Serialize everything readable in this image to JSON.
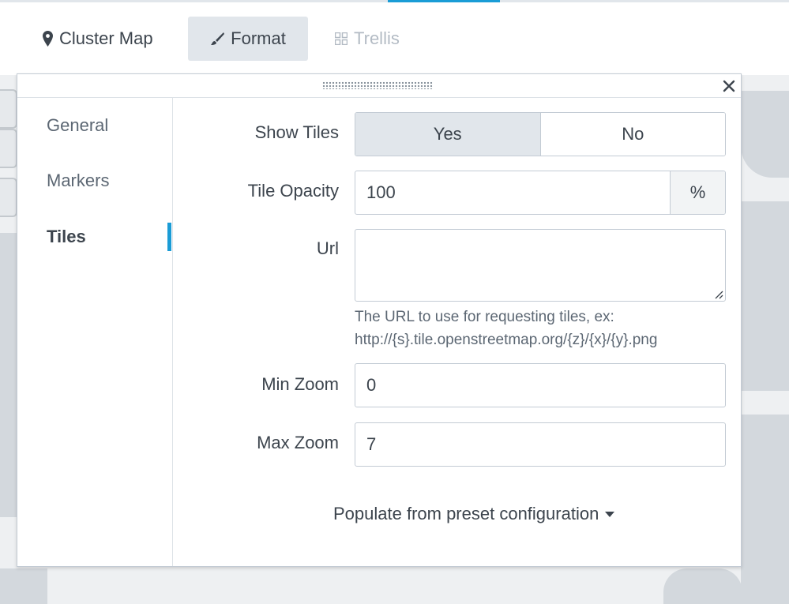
{
  "toolbar": {
    "cluster_map_label": "Cluster Map",
    "format_label": "Format",
    "trellis_label": "Trellis"
  },
  "panel": {
    "side_nav": [
      {
        "label": "General"
      },
      {
        "label": "Markers"
      },
      {
        "label": "Tiles",
        "active": true
      }
    ],
    "show_tiles": {
      "label": "Show Tiles",
      "options": [
        "Yes",
        "No"
      ],
      "selected": "Yes"
    },
    "tile_opacity": {
      "label": "Tile Opacity",
      "value": "100",
      "unit": "%"
    },
    "url": {
      "label": "Url",
      "value": "",
      "help_line1": "The URL to use for requesting tiles, ex:",
      "help_line2": "http://{s}.tile.openstreetmap.org/{z}/{x}/{y}.png"
    },
    "min_zoom": {
      "label": "Min Zoom",
      "value": "0"
    },
    "max_zoom": {
      "label": "Max Zoom",
      "value": "7"
    },
    "preset_label": "Populate from preset configuration"
  },
  "colors": {
    "accent": "#1a9cd6",
    "selected_bg": "#e1e6eb",
    "border": "#c3cbd4",
    "text": "#3c444d",
    "disabled_text": "#b3bbc4"
  },
  "icons": {
    "cluster_map": "map-pin-icon",
    "format": "paintbrush-icon",
    "trellis": "grid-icon",
    "close": "close-icon",
    "drag": "drag-handle-icon",
    "preset": "caret-down-icon"
  }
}
